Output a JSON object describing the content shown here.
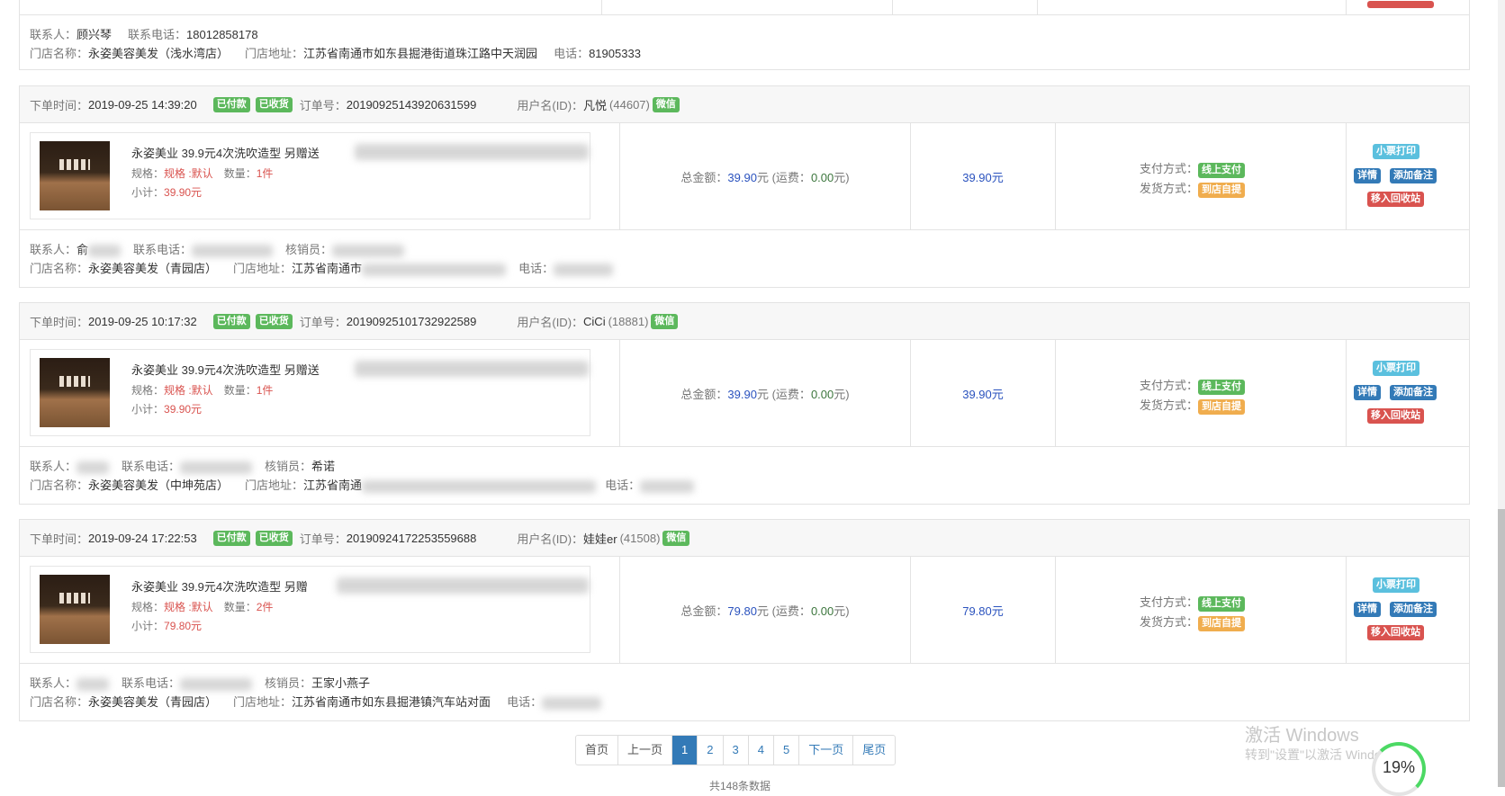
{
  "labels": {
    "order_time": "下单时间：",
    "order_no": "订单号：",
    "username": "用户名(ID)：",
    "spec": "规格：",
    "qty": "数量：",
    "subtotal": "小计：",
    "total": "总金额：",
    "shipping_prefix": "(运费：",
    "shipping_suffix": "元)",
    "yuan": "元",
    "pay_method": "支付方式：",
    "ship_method": "发货方式：",
    "contact": "联系人：",
    "phone": "联系电话：",
    "verifier": "核销员：",
    "store_name": "门店名称：",
    "store_addr": "门店地址：",
    "tel": "电话："
  },
  "badges": {
    "paid": "已付款",
    "received": "已收货",
    "wechat": "微信",
    "online_pay": "线上支付",
    "pickup": "到店自提"
  },
  "actions": {
    "print": "小票打印",
    "detail": "详情",
    "add_note": "添加备注",
    "recycle": "移入回收站"
  },
  "top_partial": {
    "contact": "顾兴琴",
    "phone": "18012858178",
    "store_name": "永姿美容美发（浅水湾店）",
    "store_addr": "江苏省南通市如东县掘港街道珠江路中天润园",
    "tel": "81905333"
  },
  "orders": [
    {
      "time": "2019-09-25 14:39:20",
      "order_no": "20190925143920631599",
      "username": "凡悦",
      "user_id": "(44607)",
      "product": "永姿美业 39.9元4次洗吹造型 另赠送",
      "spec": "规格 :默认",
      "qty": "1件",
      "subtotal": "39.90元",
      "total": "39.90",
      "shipping": "0.00",
      "amount": "39.90元",
      "contact": "俞",
      "verifier": "",
      "store_name": "永姿美容美发（青园店）",
      "store_addr": "江苏省南通市"
    },
    {
      "time": "2019-09-25 10:17:32",
      "order_no": "20190925101732922589",
      "username": "CiCi",
      "user_id": "(18881)",
      "product": "永姿美业 39.9元4次洗吹造型 另赠送",
      "spec": "规格 :默认",
      "qty": "1件",
      "subtotal": "39.90元",
      "total": "39.90",
      "shipping": "0.00",
      "amount": "39.90元",
      "contact": "",
      "verifier": "希诺",
      "store_name": "永姿美容美发（中坤苑店）",
      "store_addr": "江苏省南通"
    },
    {
      "time": "2019-09-24 17:22:53",
      "order_no": "20190924172253559688",
      "username": "娃娃er",
      "user_id": "(41508)",
      "product": "永姿美业 39.9元4次洗吹造型 另赠",
      "spec": "规格 :默认",
      "qty": "2件",
      "subtotal": "79.80元",
      "total": "79.80",
      "shipping": "0.00",
      "amount": "79.80元",
      "contact": "",
      "verifier": "王家小燕子",
      "store_name": "永姿美容美发（青园店）",
      "store_addr": "江苏省南通市如东县掘港镇汽车站对面"
    }
  ],
  "pager": {
    "first": "首页",
    "prev": "上一页",
    "pages": [
      "1",
      "2",
      "3",
      "4",
      "5"
    ],
    "next": "下一页",
    "last": "尾页",
    "count": "共148条数据"
  },
  "watermark": {
    "line1": "激活 Windows",
    "line2": "转到\"设置\"以激活 Windows。"
  },
  "gauge": {
    "value": "19%"
  }
}
